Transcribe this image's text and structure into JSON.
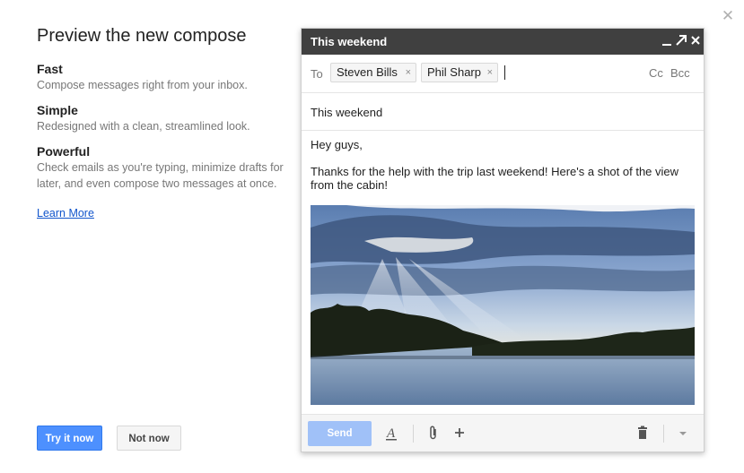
{
  "dialog": {
    "close_glyph": "✕"
  },
  "promo": {
    "headline": "Preview the new compose",
    "features": [
      {
        "title": "Fast",
        "description": "Compose messages right from your inbox."
      },
      {
        "title": "Simple",
        "description": "Redesigned with a clean, streamlined look."
      },
      {
        "title": "Powerful",
        "description": "Check emails as you're typing, minimize drafts for later, and even compose two messages at once."
      }
    ],
    "learn_more": "Learn More",
    "try_button": "Try it now",
    "not_now_button": "Not now"
  },
  "compose": {
    "title": "This weekend",
    "to_label": "To",
    "recipients": [
      "Steven Bills",
      "Phil Sharp"
    ],
    "remove_glyph": "×",
    "cc_label": "Cc",
    "bcc_label": "Bcc",
    "subject": "This weekend",
    "body_greeting": "Hey guys,",
    "body_text": "Thanks for the help with the trip last weekend!  Here's a shot of the view from the cabin!",
    "send_label": "Send",
    "icons": [
      "minimize-icon",
      "popout-icon",
      "close-icon",
      "formatting-icon",
      "attach-icon",
      "insert-more-icon",
      "discard-icon",
      "more-options-icon"
    ]
  },
  "colors": {
    "accent_blue": "#4d90fe",
    "titlebar": "#404040",
    "send_disabled": "#a0c1f8",
    "link": "#1155cc"
  }
}
